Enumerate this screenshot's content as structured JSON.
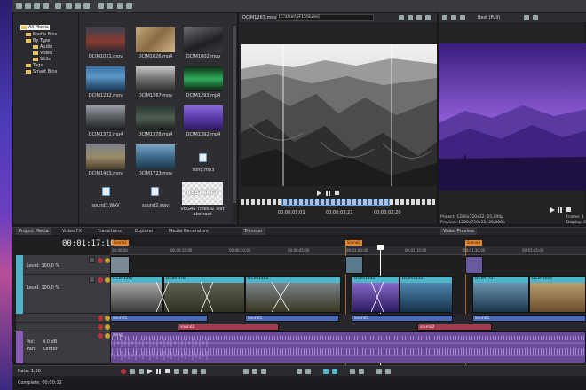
{
  "media_tree": [
    {
      "label": "All Media",
      "selected": true
    },
    {
      "label": "Media Bins"
    },
    {
      "label": "By Type"
    },
    {
      "label": "Audio"
    },
    {
      "label": "Video"
    },
    {
      "label": "Stills"
    },
    {
      "label": "Tags"
    },
    {
      "label": "Smart Bins"
    }
  ],
  "media_items": [
    "DCIM1021.mov",
    "DCIM1026.mp4",
    "DCIM1002.mov",
    "DCIM1232.mov",
    "DCIM1267.mov",
    "DCIM1293.mp4",
    "DCIM1372.mp4",
    "DCIM1378.mp4",
    "DCIM1392.mp4",
    "DCIM1463.mov",
    "DCIM1723.mov",
    "song.mp3",
    "sound1.WAV",
    "sound2.wav",
    "VEGAS Titles & Text abstract"
  ],
  "title_thumb_text": "ABSTRACT",
  "trimmer": {
    "file": "DCIM1267.mov",
    "path": "[C:\\User\\SF15\\Suite]",
    "in_time": "00:00:01;01",
    "duration": "00:00:03;21",
    "out_time": "00:00:02;20"
  },
  "preview": {
    "quality": "Best (Full)",
    "project_label": "Project:",
    "project_value": "1280x720x32; 25,000p",
    "preview_label": "Preview:",
    "preview_value": "1280x720x32; 25,000p",
    "frame_label": "Frame:",
    "display_label": "Display:",
    "frame_value": "1",
    "display_value": "69"
  },
  "tabs_left": [
    "Project Media",
    "Video FX",
    "Transitions",
    "Explorer",
    "Media Generators"
  ],
  "tab_trimmer": "Trimmer",
  "tab_video_preview": "Video Preview",
  "timeline": {
    "timecode": "00:01:17:10",
    "ruler": [
      "00:00:00",
      "00:00:15:00",
      "00:00:30:00",
      "00:00:45:00",
      "00:01:00:00",
      "00:01:15:00",
      "00:01:30:00",
      "00:01:45:00"
    ],
    "markers": [
      "Scene1",
      "Scene2",
      "Scene3"
    ],
    "track1_level": "Level: 100,0 %",
    "track2_level": "Level: 100,0 %",
    "audio_vol": "Vol:",
    "audio_vol_value": "0,0 dB",
    "audio_pan": "Pan:",
    "audio_pan_value": "Center",
    "rate": "Rate: 1,00",
    "complete": "Complete: 00:00:12"
  },
  "clips_video": [
    "DCIM1267",
    "DCIM 378",
    "DCIM1463",
    "DCIM1392",
    "DCIM1232",
    "DCIM1723",
    "DCIM1026"
  ],
  "clips_audio": [
    "sound1",
    "sound1",
    "sound2",
    "sound1",
    "sound1",
    "sound2"
  ],
  "song_label": "song"
}
